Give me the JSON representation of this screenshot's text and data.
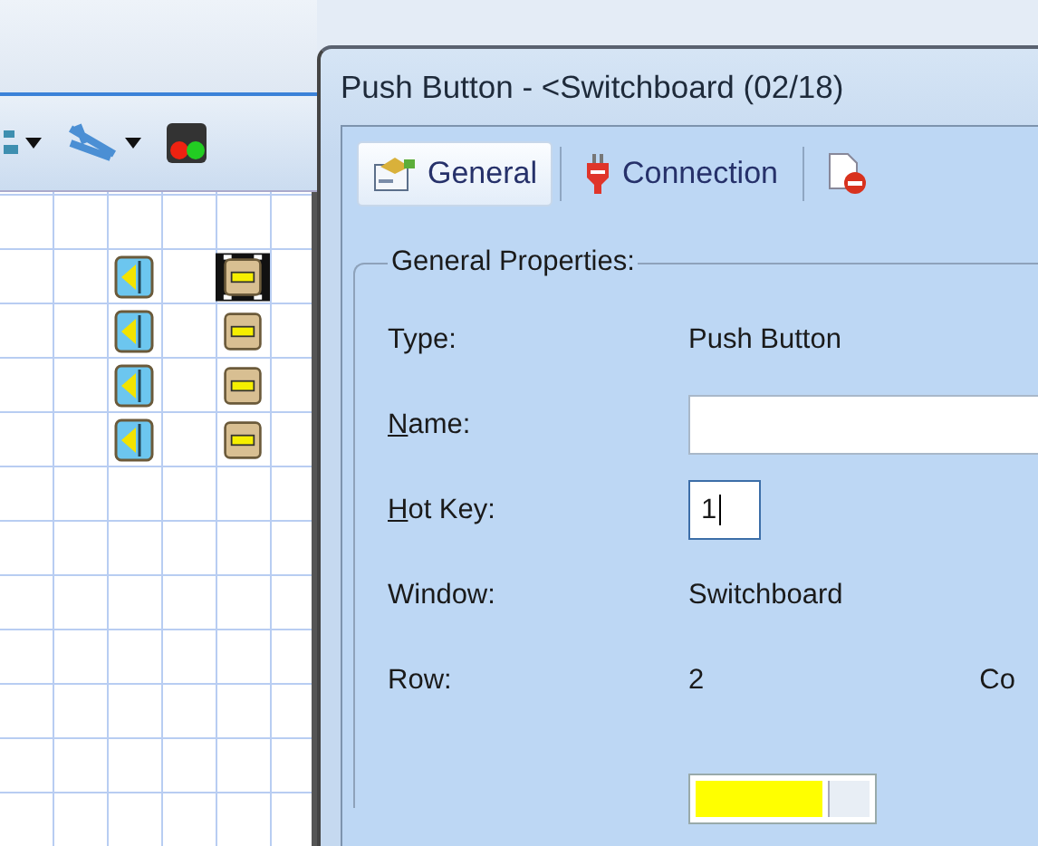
{
  "canvas": {
    "items": [
      {
        "selected": true
      },
      {
        "selected": false
      },
      {
        "selected": false
      },
      {
        "selected": false
      }
    ]
  },
  "dialog": {
    "title": "Push Button - <Switchboard (02/18)",
    "tabs": [
      {
        "label": "General",
        "selected": true
      },
      {
        "label": "Connection",
        "selected": false
      },
      {
        "selected": false
      }
    ],
    "group": {
      "legend": "General Properties:",
      "fields": [
        {
          "kind": "text",
          "label": "Type:",
          "value": "Push Button"
        },
        {
          "kind": "input",
          "label": "Name:",
          "access_key": true
        },
        {
          "kind": "input_short",
          "label": "Hot Key:",
          "access_key": true,
          "value": "1",
          "focused": true
        },
        {
          "kind": "text",
          "label": "Window:",
          "value": "Switchboard"
        },
        {
          "kind": "text",
          "label": "Row:",
          "value": "2",
          "extra": "Co"
        },
        {
          "kind": "color",
          "color": "#ffff00"
        }
      ]
    }
  }
}
